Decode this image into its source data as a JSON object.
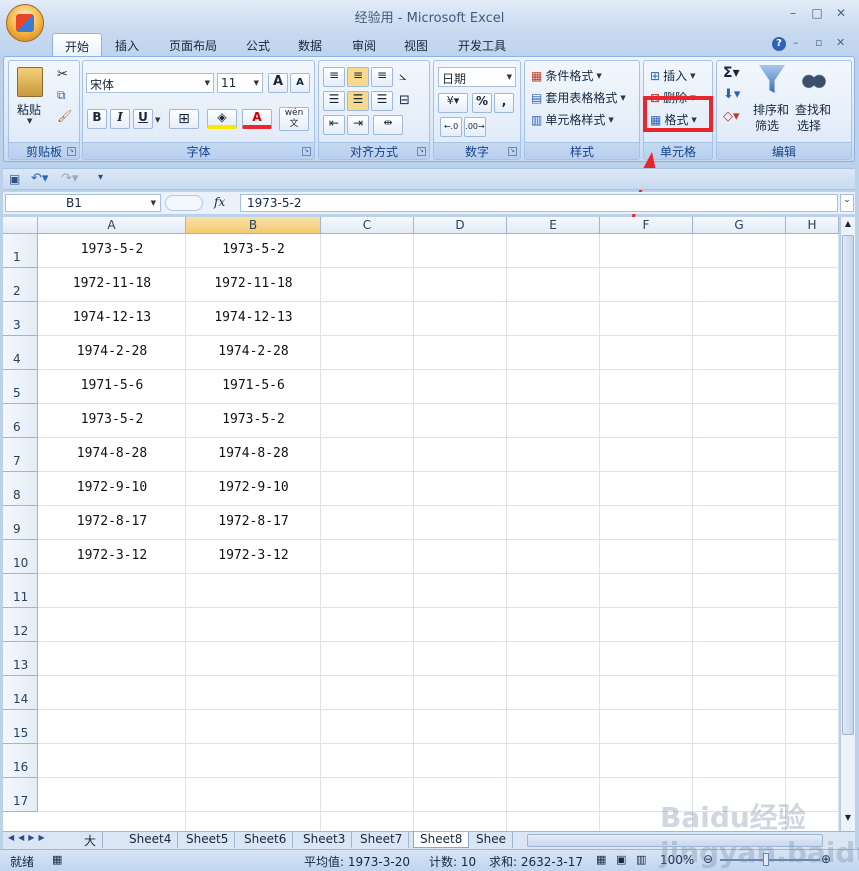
{
  "window": {
    "title": "经验用 - Microsoft Excel",
    "min": "–",
    "restore": "□",
    "close": "✕"
  },
  "tabs": [
    "开始",
    "插入",
    "页面布局",
    "公式",
    "数据",
    "审阅",
    "视图",
    "开发工具"
  ],
  "ribbon": {
    "clipboard": {
      "label": "剪贴板",
      "paste": "粘贴"
    },
    "font": {
      "label": "字体",
      "name": "宋体",
      "size": "11",
      "bold": "B",
      "italic": "I",
      "underline": "U",
      "grow": "A",
      "shrink": "A",
      "wen": "wén 文"
    },
    "alignment": {
      "label": "对齐方式"
    },
    "number": {
      "label": "数字",
      "format": "日期",
      "percent": "%",
      "comma": ","
    },
    "styles": {
      "label": "样式",
      "conditional": "条件格式",
      "table": "套用表格格式",
      "cell": "单元格样式"
    },
    "cells": {
      "label": "单元格",
      "insert": "插入",
      "delete": "删除",
      "format": "格式"
    },
    "editing": {
      "label": "编辑",
      "sort": "排序和",
      "sort2": "筛选",
      "find": "查找和",
      "find2": "选择"
    }
  },
  "formula_bar": {
    "name_box": "B1",
    "fx": "fx",
    "value": "1973-5-2"
  },
  "columns": [
    "A",
    "B",
    "C",
    "D",
    "E",
    "F",
    "G",
    "H"
  ],
  "rows": [
    "1",
    "2",
    "3",
    "4",
    "5",
    "6",
    "7",
    "8",
    "9",
    "10",
    "11",
    "12",
    "13",
    "14",
    "15",
    "16",
    "17"
  ],
  "cells": [
    [
      "1973-5-2",
      "1973-5-2"
    ],
    [
      "1972-11-18",
      "1972-11-18"
    ],
    [
      "1974-12-13",
      "1974-12-13"
    ],
    [
      "1974-2-28",
      "1974-2-28"
    ],
    [
      "1971-5-6",
      "1971-5-6"
    ],
    [
      "1973-5-2",
      "1973-5-2"
    ],
    [
      "1974-8-28",
      "1974-8-28"
    ],
    [
      "1972-9-10",
      "1972-9-10"
    ],
    [
      "1972-8-17",
      "1972-8-17"
    ],
    [
      "1972-3-12",
      "1972-3-12"
    ]
  ],
  "sheets": [
    "大写",
    "Sheet4",
    "Sheet5",
    "Sheet6",
    "Sheet3",
    "Sheet7",
    "Sheet8",
    "Shee"
  ],
  "active_sheet": "Sheet8",
  "status": {
    "ready": "就绪",
    "average": "平均值: 1973-3-20",
    "count": "计数: 10",
    "sum": "求和: 2632-3-17",
    "zoom": "100%"
  },
  "watermark": "Baidu经验 jingyan.baidu.com",
  "colors": {
    "highlight": "#e8262b",
    "ribbon": "#dbe7f6"
  }
}
